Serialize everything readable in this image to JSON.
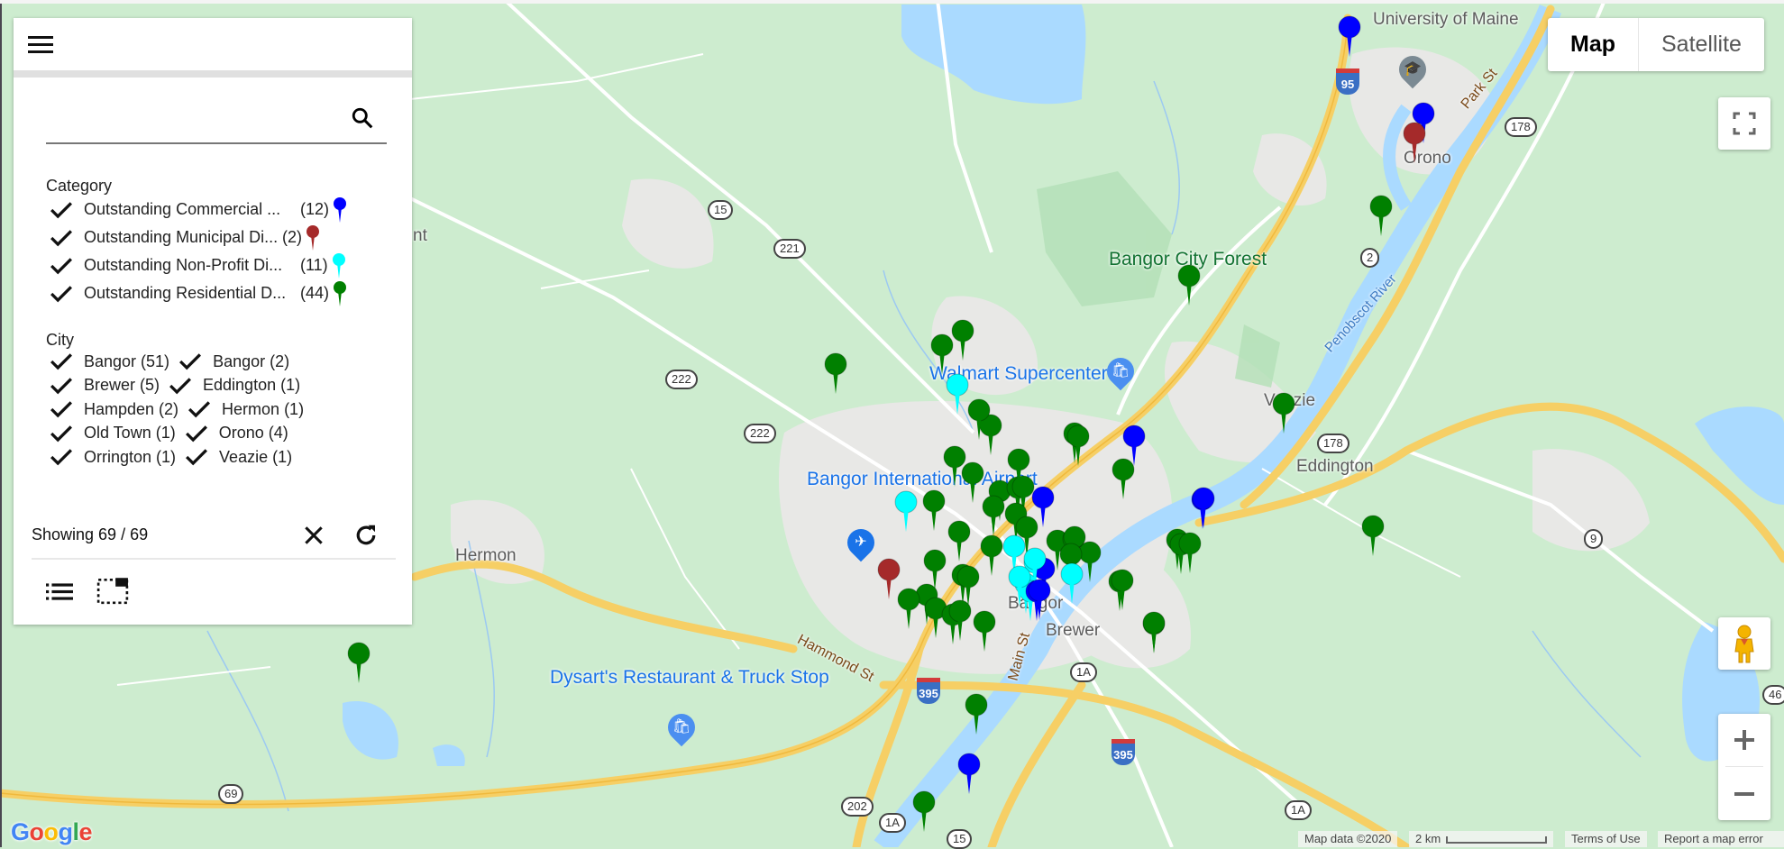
{
  "panel": {
    "search": {
      "value": "",
      "placeholder": ""
    },
    "category_title": "Category",
    "categories": [
      {
        "label": "Outstanding Commercial ...",
        "count": "(12)",
        "color": "#0000ff",
        "checked": true
      },
      {
        "label": "Outstanding Municipal Di...",
        "count": "(2)",
        "color": "#a52a2a",
        "checked": true
      },
      {
        "label": "Outstanding Non-Profit Di...",
        "count": "(11)",
        "color": "#00ffff",
        "checked": true
      },
      {
        "label": "Outstanding Residential D...",
        "count": "(44)",
        "color": "#008000",
        "checked": true
      }
    ],
    "city_title": "City",
    "cities": [
      [
        "Bangor (51)",
        "Bangor (2)"
      ],
      [
        "Brewer (5)",
        "Eddington (1)"
      ],
      [
        "Hampden (2)",
        "Hermon (1)"
      ],
      [
        "Old Town (1)",
        "Orono (4)"
      ],
      [
        "Orrington (1)",
        "Veazie (1)"
      ]
    ],
    "status": "Showing 69 / 69",
    "icons": {
      "menu": "menu-icon",
      "search": "search-icon",
      "check": "check-icon",
      "clear": "close-icon",
      "refresh": "refresh-icon",
      "list": "list-icon",
      "select": "select-area-icon"
    }
  },
  "map_controls": {
    "map_type": {
      "map": "Map",
      "satellite": "Satellite",
      "selected": "Map"
    },
    "attribution": "Map data ©2020",
    "scale": "2 km",
    "terms": "Terms of Use",
    "report": "Report a map error",
    "logo": "Google"
  },
  "map_labels": {
    "places": [
      "University of Maine",
      "Orono",
      "Bangor City Forest",
      "Walmart Supercenter",
      "Veazie",
      "Eddington",
      "Bangor International Airport",
      "Hermon",
      "Bangor",
      "Brewer",
      "Dysart's Restaurant & Truck Stop"
    ],
    "streets": [
      "Hammond St",
      "Main St",
      "Park St"
    ],
    "water": [
      "Penobscot River"
    ],
    "routes": [
      "95",
      "15",
      "221",
      "222",
      "222",
      "178",
      "178",
      "2",
      "9",
      "1A",
      "1A",
      "1A",
      "202",
      "395",
      "395",
      "69",
      "15",
      "46"
    ]
  },
  "markers": {
    "total_shown": 69,
    "category_colors": {
      "commercial": "#0000ff",
      "municipal": "#a52a2a",
      "nonprofit": "#00ffff",
      "residential": "#008000"
    }
  }
}
